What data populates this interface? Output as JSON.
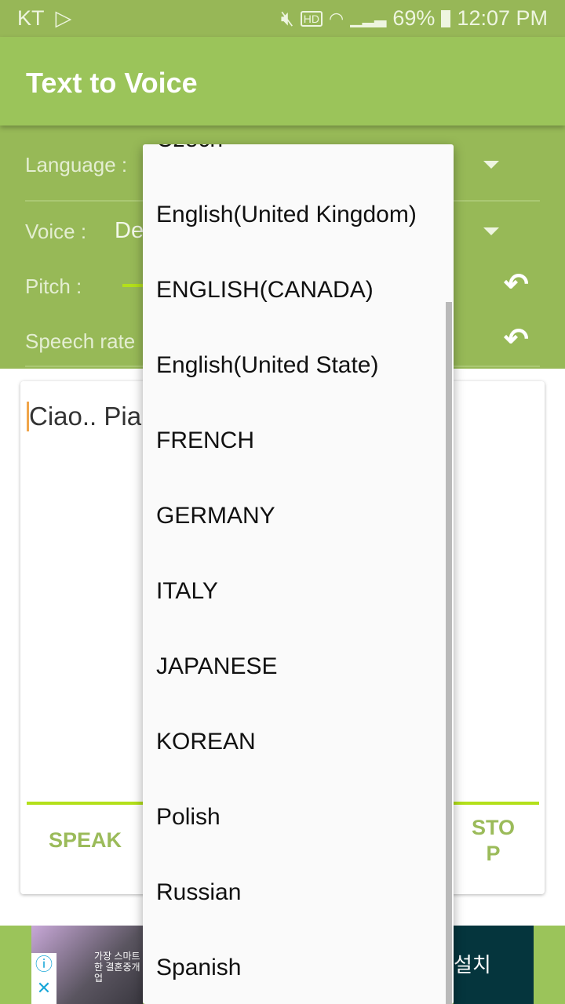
{
  "status_bar": {
    "carrier": "KT",
    "battery": "69%",
    "time": "12:07 PM",
    "icons": [
      "play-store-icon",
      "mute-icon",
      "hd-voice-icon",
      "wifi-icon",
      "signal-icon",
      "battery-charging-icon"
    ]
  },
  "app_bar": {
    "title": "Text to Voice"
  },
  "controls": {
    "language_label": "Language :",
    "voice_label": "Voice :",
    "voice_value_partial": "De",
    "pitch_label": "Pitch :",
    "speech_rate_label": "Speech rate"
  },
  "editor": {
    "text_partial": "Ciao.. Pia"
  },
  "buttons": {
    "speak": "SPEAK",
    "stop": "STO P"
  },
  "ad": {
    "image_text": "가장 스마트한 결혼중개업",
    "install": "설치"
  },
  "dropdown": {
    "items": [
      "Czech",
      "English(United Kingdom)",
      "ENGLISH(CANADA)",
      "English(United State)",
      "FRENCH",
      "GERMANY",
      "ITALY",
      "JAPANESE",
      "KOREAN",
      "Polish",
      "Russian",
      "Spanish"
    ]
  },
  "colors": {
    "primary": "#9bc45a",
    "accent": "#b3e01a",
    "button_text": "#9bbb5a"
  }
}
